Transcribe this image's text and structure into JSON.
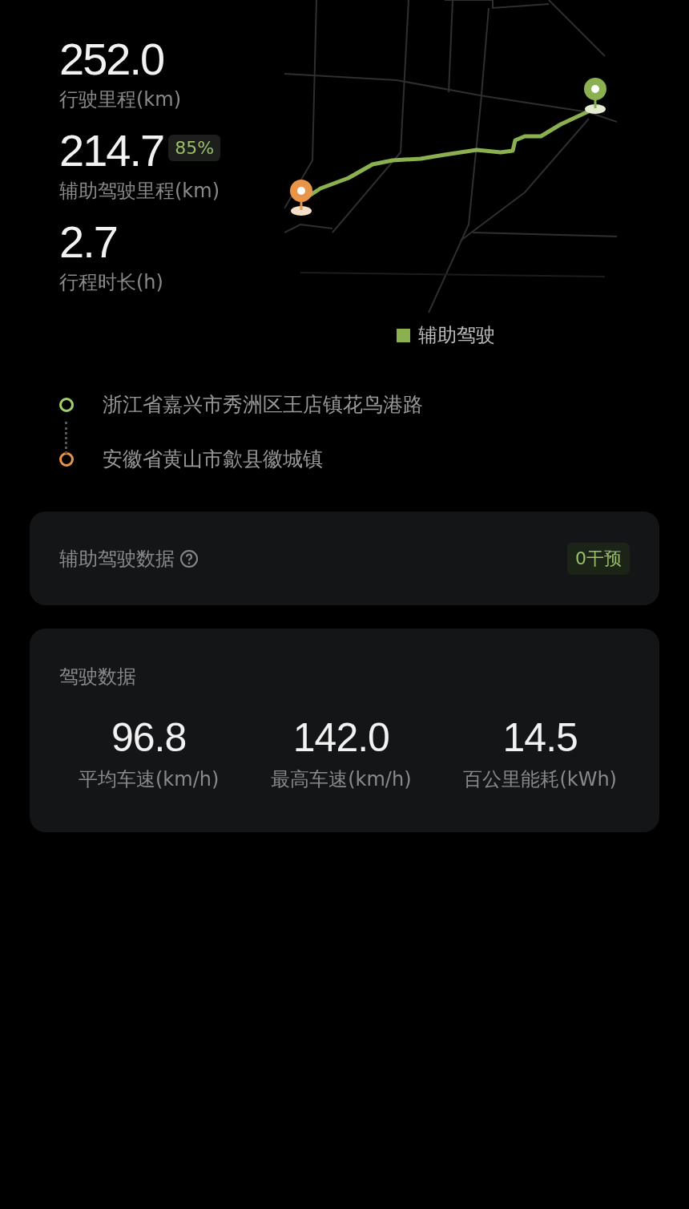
{
  "stats": [
    {
      "value": "252.0",
      "label": "行驶里程(km)"
    },
    {
      "value": "214.7",
      "badge": "85%",
      "label": "辅助驾驶里程(km)"
    },
    {
      "value": "2.7",
      "label": "行程时长(h)"
    }
  ],
  "legend": "辅助驾驶",
  "route": [
    {
      "kind": "start",
      "address": "浙江省嘉兴市秀洲区王店镇花鸟港路"
    },
    {
      "kind": "end",
      "address": "安徽省黄山市歙县徽城镇"
    }
  ],
  "assist_card": {
    "title": "辅助驾驶数据",
    "badge": "0干预"
  },
  "driving_card": {
    "title": "驾驶数据",
    "metrics": [
      {
        "value": "96.8",
        "label": "平均车速(km/h)"
      },
      {
        "value": "142.0",
        "label": "最高车速(km/h)"
      },
      {
        "value": "14.5",
        "label": "百公里能耗(kWh)"
      }
    ]
  }
}
